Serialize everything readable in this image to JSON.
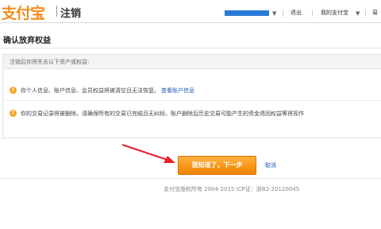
{
  "header": {
    "logo": "支付宝",
    "section_title": "注销",
    "user_name": "",
    "nav": [
      "退出",
      "我的支付宝",
      "易"
    ]
  },
  "page_title": "确认放弃权益",
  "notice_box": {
    "heading": "注销后你将失去以下资产或权益:",
    "items": [
      {
        "text": "你个人信息、账户信息、会员权益将被清空且无法恢复。",
        "link": "查看账户信息"
      },
      {
        "text": "你的交易记录将被删除。请确保所有的交易已完结且无纠纷。账户删除后历史交易可能产生的资金退回权益等将视作",
        "link": ""
      }
    ]
  },
  "actions": {
    "next_label": "我知道了，下一步",
    "cancel_label": "取消"
  },
  "footer": "支付宝版权所有 2004-2015 ICP证：浙B2-20120045",
  "colors": {
    "accent": "#f08200",
    "link": "#1a5bb5",
    "arrow": "#e8202a",
    "user_bar": "#2a7bd6"
  }
}
